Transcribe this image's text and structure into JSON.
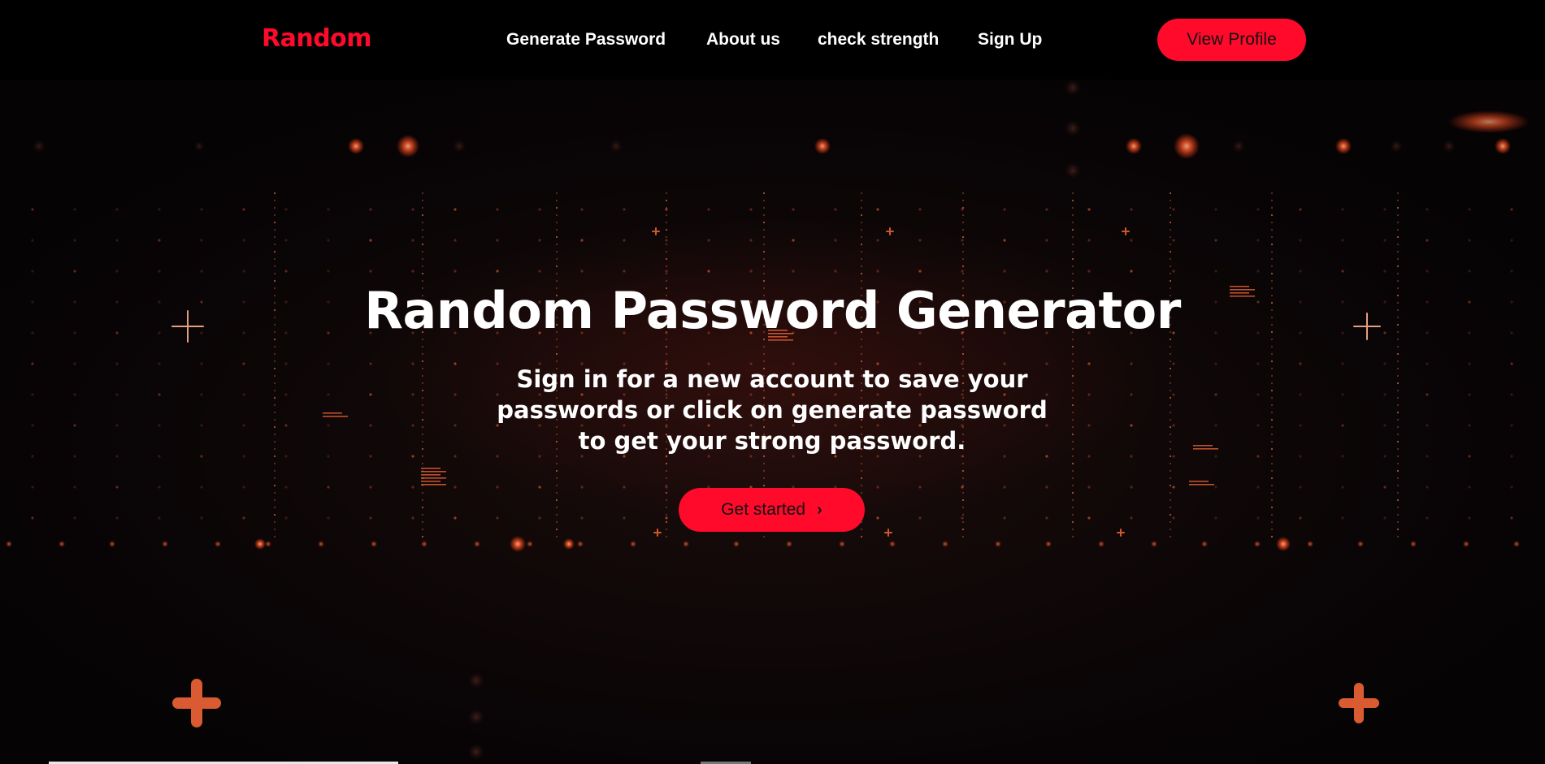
{
  "navbar": {
    "brand": "Random",
    "links": [
      "Generate Password",
      "About us",
      "check strength",
      "Sign Up"
    ],
    "profile_button": "View Profile"
  },
  "hero": {
    "title": "Random Password Generator",
    "subtitle": "Sign in for a new account to save your passwords or click on generate password to get your strong password.",
    "cta_label": "Get started",
    "cta_icon": "chevron-right-icon"
  },
  "colors": {
    "accent": "#ff0a2b",
    "background": "#000000",
    "glow": "#ff5a2a"
  }
}
